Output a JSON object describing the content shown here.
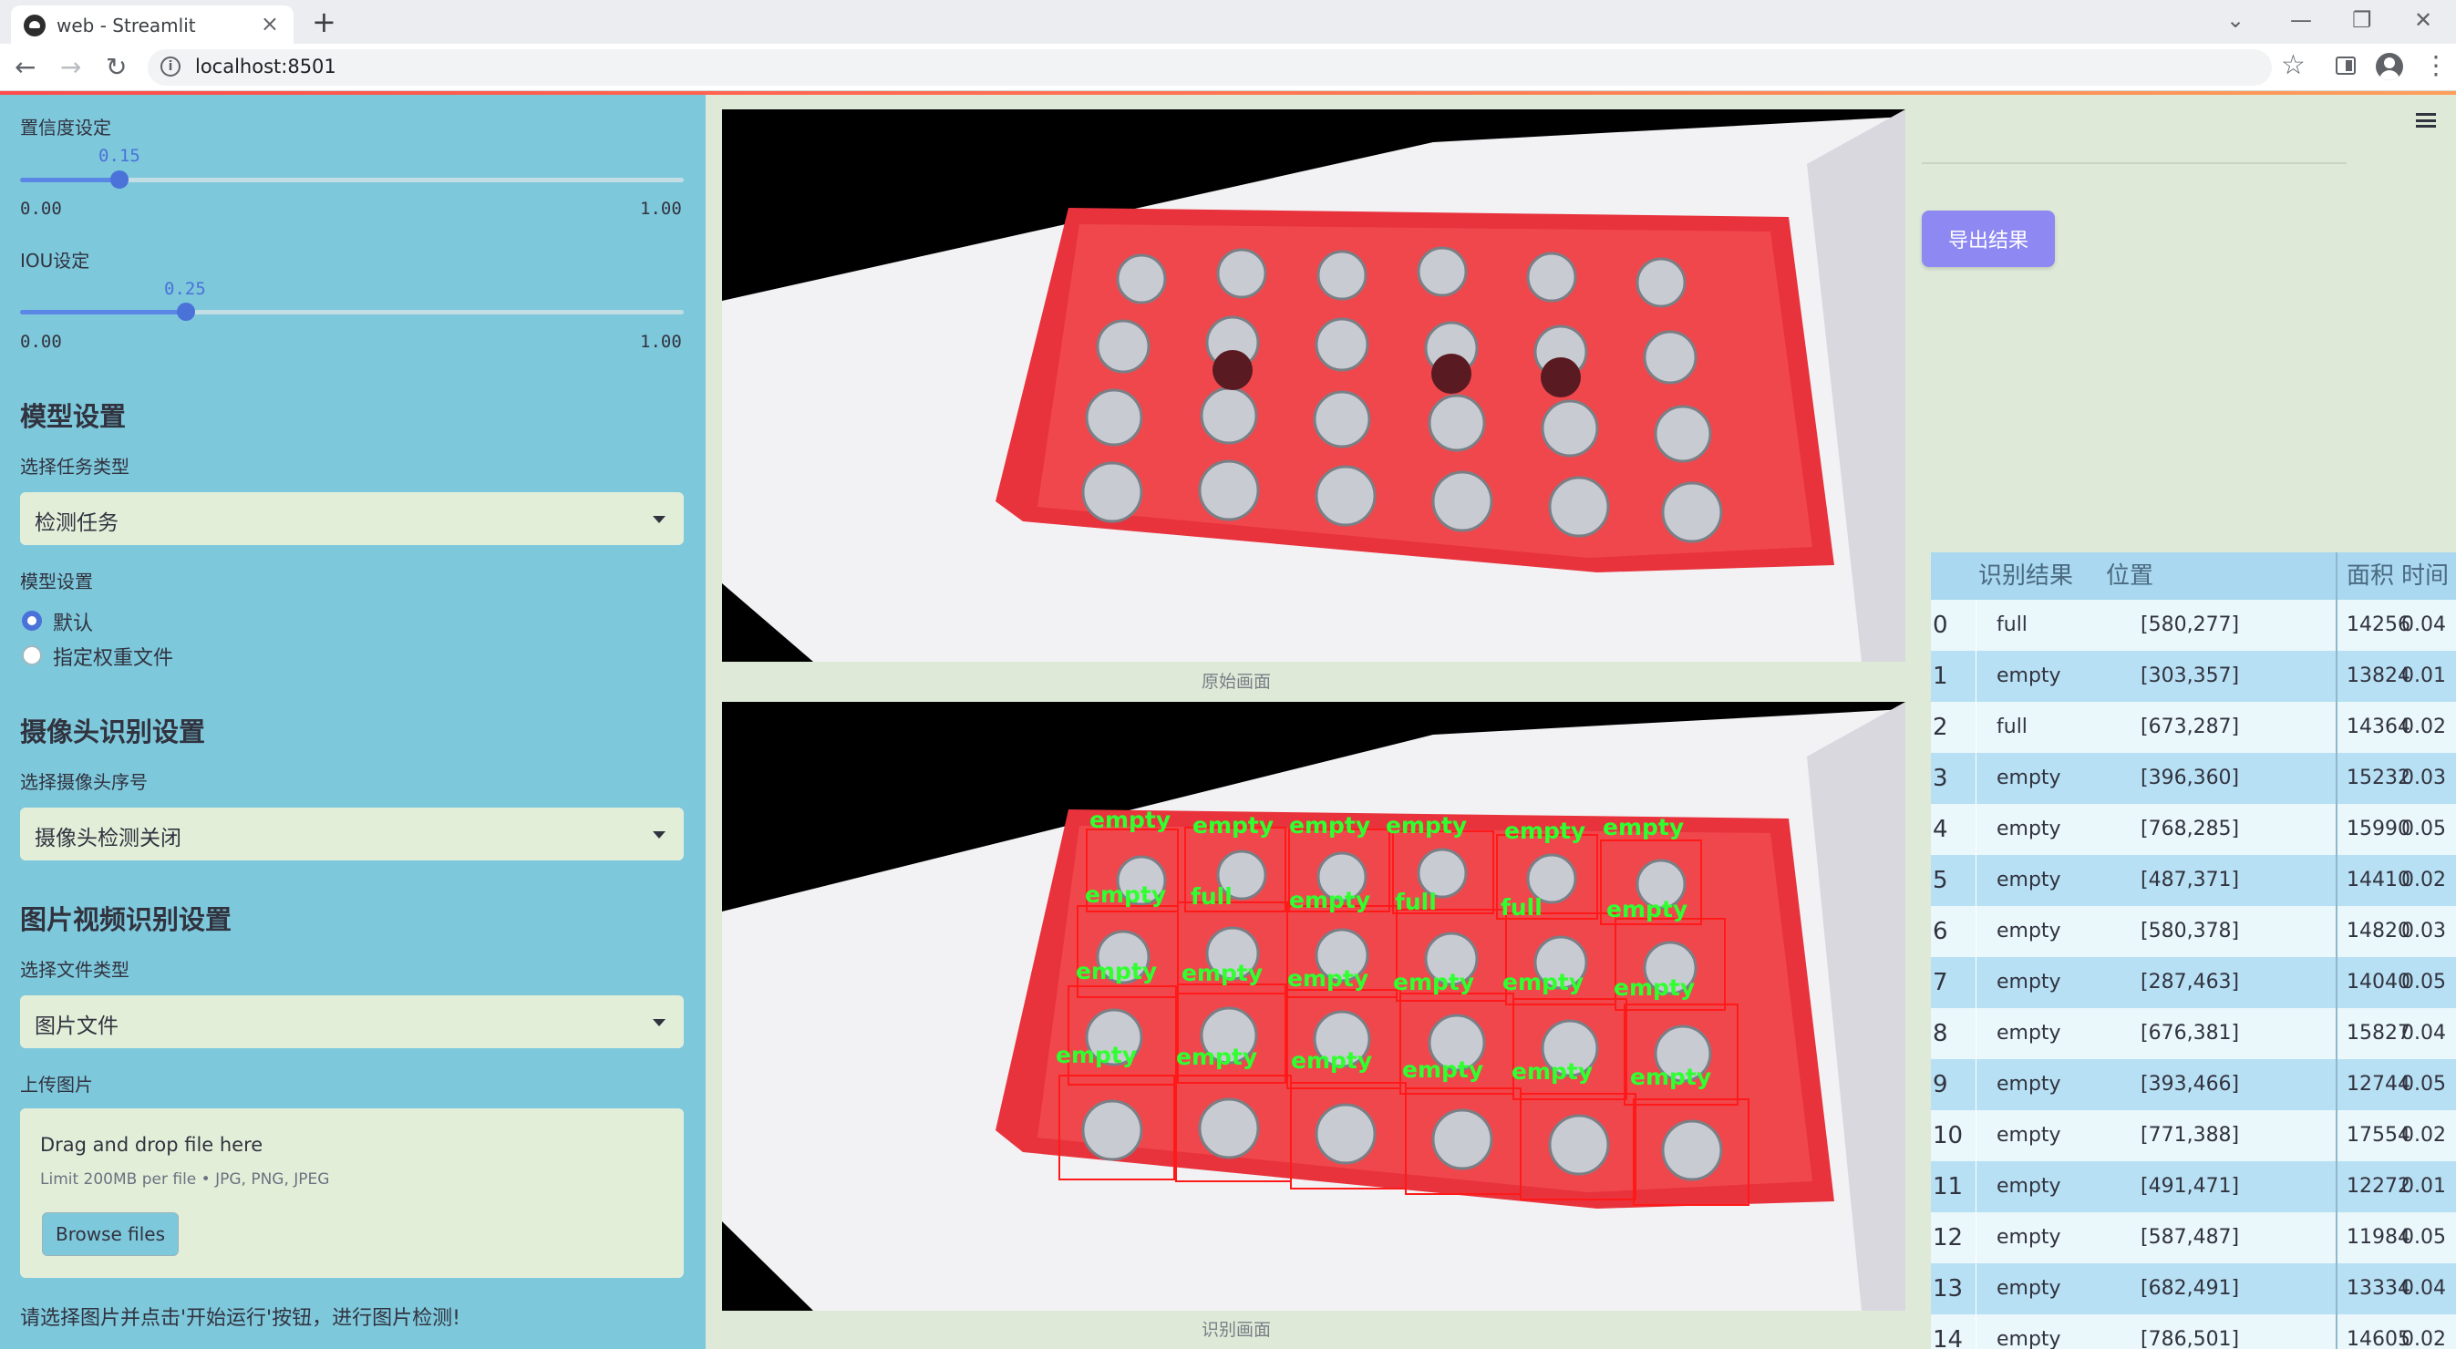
{
  "browser": {
    "tab_title": "web - Streamlit",
    "url": "localhost:8501"
  },
  "sidebar": {
    "confidence_label": "置信度设定",
    "confidence_value": "0.15",
    "confidence_fraction": 0.15,
    "iou_label": "IOU设定",
    "iou_value": "0.25",
    "iou_fraction": 0.25,
    "slider_min": "0.00",
    "slider_max": "1.00",
    "model_heading": "模型设置",
    "task_type_label": "选择任务类型",
    "task_type_value": "检测任务",
    "model_settings_label": "模型设置",
    "radio_default": "默认",
    "radio_custom": "指定权重文件",
    "camera_heading": "摄像头识别设置",
    "camera_select_label": "选择摄像头序号",
    "camera_select_value": "摄像头检测关闭",
    "media_heading": "图片视频识别设置",
    "file_type_label": "选择文件类型",
    "file_type_value": "图片文件",
    "upload_label": "上传图片",
    "upload_title": "Drag and drop file here",
    "upload_limit": "Limit 200MB per file • JPG, PNG, JPEG",
    "browse_button": "Browse files",
    "hint": "请选择图片并点击'开始运行'按钮，进行图片检测!"
  },
  "main": {
    "original_caption": "原始画面",
    "result_caption": "识别画面",
    "labels": {
      "full": "full",
      "empty": "empty"
    }
  },
  "right": {
    "export_button": "导出结果",
    "table": {
      "headers": [
        "识别结果",
        "位置",
        "面积",
        "时间"
      ],
      "rows": [
        {
          "idx": "0",
          "result": "full",
          "position": "[580,277]",
          "area": "14256",
          "time": "0.04"
        },
        {
          "idx": "1",
          "result": "empty",
          "position": "[303,357]",
          "area": "13824",
          "time": "0.01"
        },
        {
          "idx": "2",
          "result": "full",
          "position": "[673,287]",
          "area": "14364",
          "time": "0.02"
        },
        {
          "idx": "3",
          "result": "empty",
          "position": "[396,360]",
          "area": "15232",
          "time": "0.03"
        },
        {
          "idx": "4",
          "result": "empty",
          "position": "[768,285]",
          "area": "15990",
          "time": "0.05"
        },
        {
          "idx": "5",
          "result": "empty",
          "position": "[487,371]",
          "area": "14410",
          "time": "0.02"
        },
        {
          "idx": "6",
          "result": "empty",
          "position": "[580,378]",
          "area": "14820",
          "time": "0.03"
        },
        {
          "idx": "7",
          "result": "empty",
          "position": "[287,463]",
          "area": "14040",
          "time": "0.05"
        },
        {
          "idx": "8",
          "result": "empty",
          "position": "[676,381]",
          "area": "15827",
          "time": "0.04"
        },
        {
          "idx": "9",
          "result": "empty",
          "position": "[393,466]",
          "area": "12744",
          "time": "0.05"
        },
        {
          "idx": "10",
          "result": "empty",
          "position": "[771,388]",
          "area": "17554",
          "time": "0.02"
        },
        {
          "idx": "11",
          "result": "empty",
          "position": "[491,471]",
          "area": "12272",
          "time": "0.01"
        },
        {
          "idx": "12",
          "result": "empty",
          "position": "[587,487]",
          "area": "11984",
          "time": "0.05"
        },
        {
          "idx": "13",
          "result": "empty",
          "position": "[682,491]",
          "area": "13334",
          "time": "0.04"
        },
        {
          "idx": "14",
          "result": "empty",
          "position": "[786,501]",
          "area": "14605",
          "time": "0.02"
        }
      ]
    }
  }
}
